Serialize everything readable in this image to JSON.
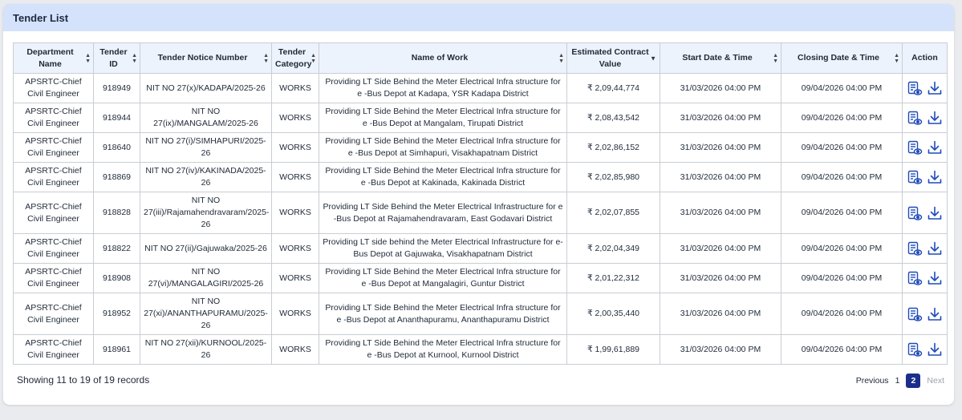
{
  "header": {
    "title": "Tender List"
  },
  "columns": [
    {
      "label": "Department Name",
      "sort": "both"
    },
    {
      "label": "Tender ID",
      "sort": "both"
    },
    {
      "label": "Tender Notice Number",
      "sort": "both"
    },
    {
      "label": "Tender Category",
      "sort": "both"
    },
    {
      "label": "Name of Work",
      "sort": "both"
    },
    {
      "label": "Estimated Contract Value",
      "sort": "desc"
    },
    {
      "label": "Start Date & Time",
      "sort": "both"
    },
    {
      "label": "Closing Date & Time",
      "sort": "both"
    },
    {
      "label": "Action",
      "sort": "none"
    }
  ],
  "rows": [
    {
      "dept": "APSRTC-Chief Civil Engineer",
      "id": "918949",
      "notice": "NIT NO 27(x)/KADAPA/2025-26",
      "category": "WORKS",
      "work": "Providing LT Side Behind the Meter Electrical Infra structure for e -Bus Depot at Kadapa, YSR Kadapa District",
      "value": "₹ 2,09,44,774",
      "start": "31/03/2026 04:00 PM",
      "close": "09/04/2026 04:00 PM"
    },
    {
      "dept": "APSRTC-Chief Civil Engineer",
      "id": "918944",
      "notice": "NIT NO 27(ix)/MANGALAM/2025-26",
      "category": "WORKS",
      "work": "Providing LT Side Behind the Meter Electrical Infra structure for e -Bus Depot at Mangalam, Tirupati District",
      "value": "₹ 2,08,43,542",
      "start": "31/03/2026 04:00 PM",
      "close": "09/04/2026 04:00 PM"
    },
    {
      "dept": "APSRTC-Chief Civil Engineer",
      "id": "918640",
      "notice": "NIT NO 27(i)/SIMHAPURI/2025-26",
      "category": "WORKS",
      "work": "Providing LT Side Behind the Meter Electrical Infra structure for e -Bus Depot at Simhapuri, Visakhapatnam District",
      "value": "₹ 2,02,86,152",
      "start": "31/03/2026 04:00 PM",
      "close": "09/04/2026 04:00 PM"
    },
    {
      "dept": "APSRTC-Chief Civil Engineer",
      "id": "918869",
      "notice": "NIT NO 27(iv)/KAKINADA/2025-26",
      "category": "WORKS",
      "work": "Providing LT Side Behind the Meter Electrical Infra structure for e -Bus Depot at Kakinada, Kakinada District",
      "value": "₹ 2,02,85,980",
      "start": "31/03/2026 04:00 PM",
      "close": "09/04/2026 04:00 PM"
    },
    {
      "dept": "APSRTC-Chief Civil Engineer",
      "id": "918828",
      "notice": "NIT NO 27(iii)/Rajamahendravaram/2025-26",
      "category": "WORKS",
      "work": "Providing LT Side Behind the Meter Electrical Infrastructure for e -Bus Depot at Rajamahendravaram, East Godavari District",
      "value": "₹ 2,02,07,855",
      "start": "31/03/2026 04:00 PM",
      "close": "09/04/2026 04:00 PM"
    },
    {
      "dept": "APSRTC-Chief Civil Engineer",
      "id": "918822",
      "notice": "NIT NO 27(ii)/Gajuwaka/2025-26",
      "category": "WORKS",
      "work": "Providing LT side behind the Meter Electrical Infrastructure for e-Bus Depot at Gajuwaka, Visakhapatnam District",
      "value": "₹ 2,02,04,349",
      "start": "31/03/2026 04:00 PM",
      "close": "09/04/2026 04:00 PM"
    },
    {
      "dept": "APSRTC-Chief Civil Engineer",
      "id": "918908",
      "notice": "NIT NO 27(vi)/MANGALAGIRI/2025-26",
      "category": "WORKS",
      "work": "Providing LT Side Behind the Meter Electrical Infra structure for e -Bus Depot at Mangalagiri, Guntur District",
      "value": "₹ 2,01,22,312",
      "start": "31/03/2026 04:00 PM",
      "close": "09/04/2026 04:00 PM"
    },
    {
      "dept": "APSRTC-Chief Civil Engineer",
      "id": "918952",
      "notice": "NIT NO 27(xi)/ANANTHAPURAMU/2025-26",
      "category": "WORKS",
      "work": "Providing LT Side Behind the Meter Electrical Infra structure for e -Bus Depot at Ananthapuramu, Ananthapuramu District",
      "value": "₹ 2,00,35,440",
      "start": "31/03/2026 04:00 PM",
      "close": "09/04/2026 04:00 PM"
    },
    {
      "dept": "APSRTC-Chief Civil Engineer",
      "id": "918961",
      "notice": "NIT NO 27(xii)/KURNOOL/2025-26",
      "category": "WORKS",
      "work": "Providing LT Side Behind the Meter Electrical Infra structure for e -Bus Depot at Kurnool, Kurnool District",
      "value": "₹ 1,99,61,889",
      "start": "31/03/2026 04:00 PM",
      "close": "09/04/2026 04:00 PM"
    }
  ],
  "actions": {
    "view_icon": "view-document-icon",
    "download_icon": "download-icon"
  },
  "footer": {
    "info": "Showing 11 to 19 of 19 records"
  },
  "pagination": {
    "previous": "Previous",
    "pages": [
      "1",
      "2"
    ],
    "current": "2",
    "next": "Next"
  },
  "colors": {
    "header_bg": "#d4e2fb",
    "th_bg": "#edf3fd",
    "icon": "#1f4bb8",
    "active_page": "#1b2f8a"
  }
}
